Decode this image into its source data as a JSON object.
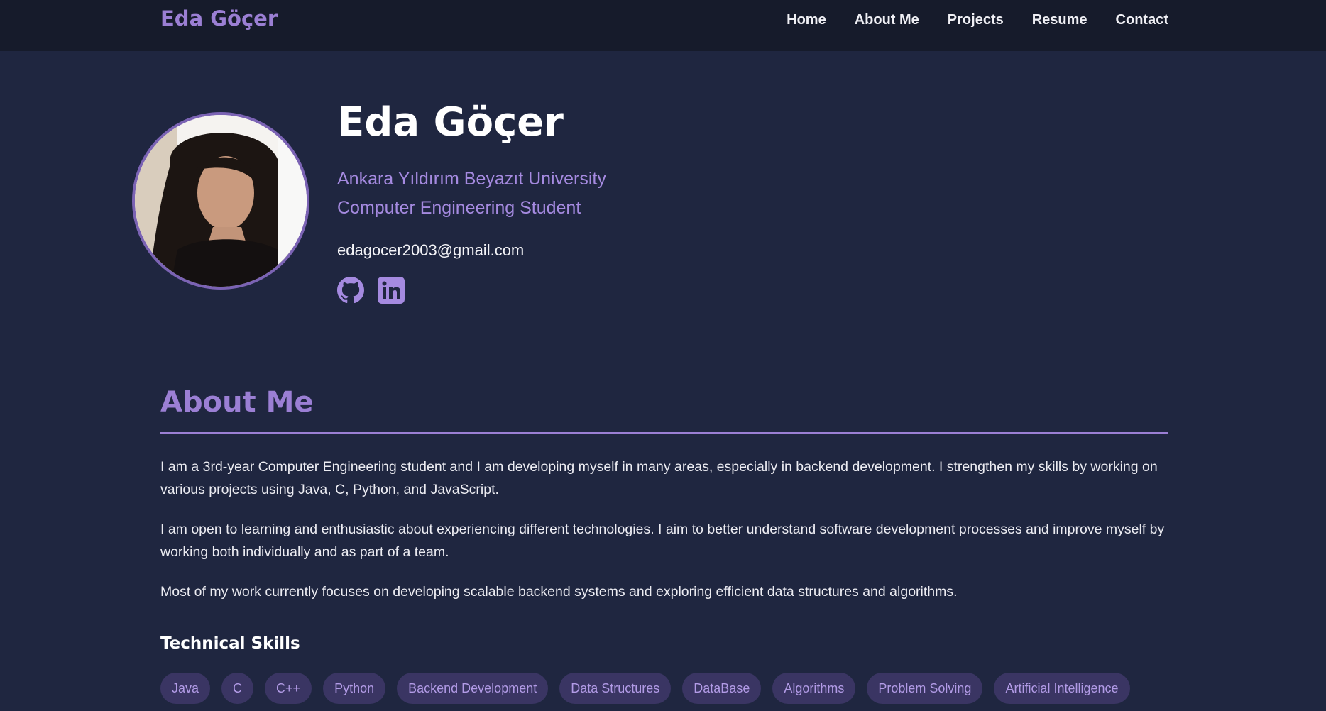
{
  "navbar": {
    "brand": "Eda Göçer",
    "links": [
      {
        "label": "Home"
      },
      {
        "label": "About Me"
      },
      {
        "label": "Projects"
      },
      {
        "label": "Resume"
      },
      {
        "label": "Contact"
      }
    ]
  },
  "hero": {
    "name": "Eda Göçer",
    "university": "Ankara Yıldırım Beyazıt University",
    "role": "Computer Engineering Student",
    "email": "edagocer2003@gmail.com",
    "social": [
      {
        "icon": "github-icon"
      },
      {
        "icon": "linkedin-icon"
      }
    ]
  },
  "about": {
    "title": "About Me",
    "paragraphs": [
      "I am a 3rd-year Computer Engineering student and I am developing myself in many areas, especially in backend development. I strengthen my skills by working on various projects using Java, C, Python, and JavaScript.",
      "I am open to learning and enthusiastic about experiencing different technologies. I aim to better understand software development processes and improve myself by working both individually and as part of a team.",
      "Most of my work currently focuses on developing scalable backend systems and exploring efficient data structures and algorithms."
    ],
    "skills_title": "Technical Skills",
    "skills": [
      "Java",
      "C",
      "C++",
      "Python",
      "Backend Development",
      "Data Structures",
      "DataBase",
      "Algorithms",
      "Problem Solving",
      "Artificial Intelligence"
    ]
  },
  "colors": {
    "background": "#1f2640",
    "navbar": "#161b2b",
    "accent": "#9b7fd4",
    "chip_bg": "#3a3563"
  }
}
